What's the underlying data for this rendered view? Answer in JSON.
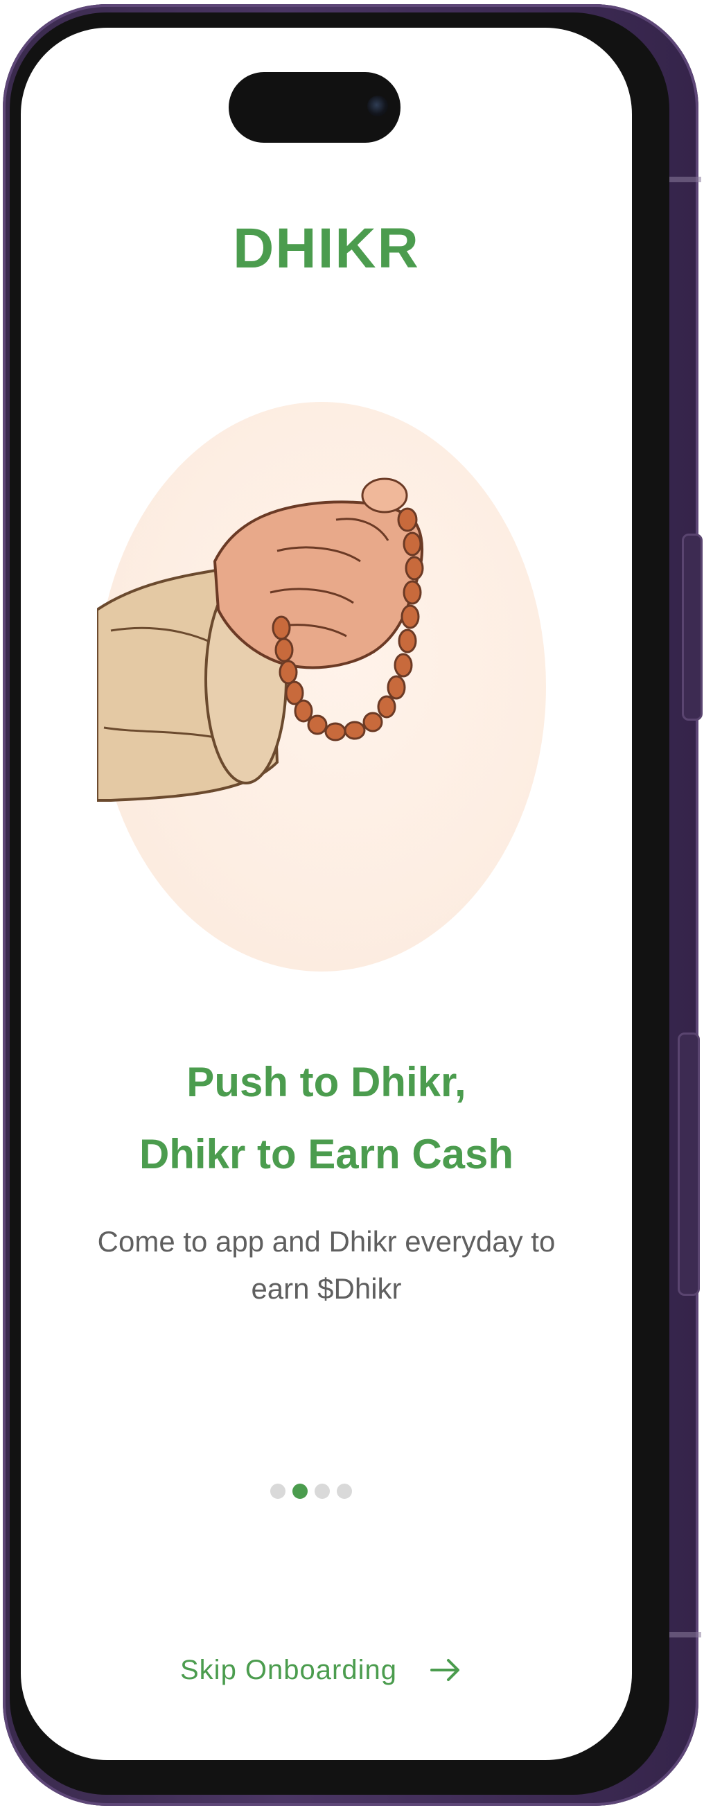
{
  "app": {
    "brand": "DHIKR"
  },
  "onboarding": {
    "headline_line1": "Push to Dhikr,",
    "headline_line2": "Dhikr to Earn Cash",
    "subtitle": "Come to app and Dhikr everyday to earn $Dhikr",
    "page_indicator": {
      "total": 4,
      "active_index": 1
    },
    "skip_label": "Skip Onboarding",
    "skip_icon": "arrow-right-icon",
    "illustration": "hand-with-prayer-beads"
  },
  "colors": {
    "accent": "#4b9c4e",
    "text_secondary": "#5f5f5f",
    "hero_bg": "#fdeee3",
    "dot_inactive": "#d9d9d9",
    "frame": "#3a2a4d"
  }
}
